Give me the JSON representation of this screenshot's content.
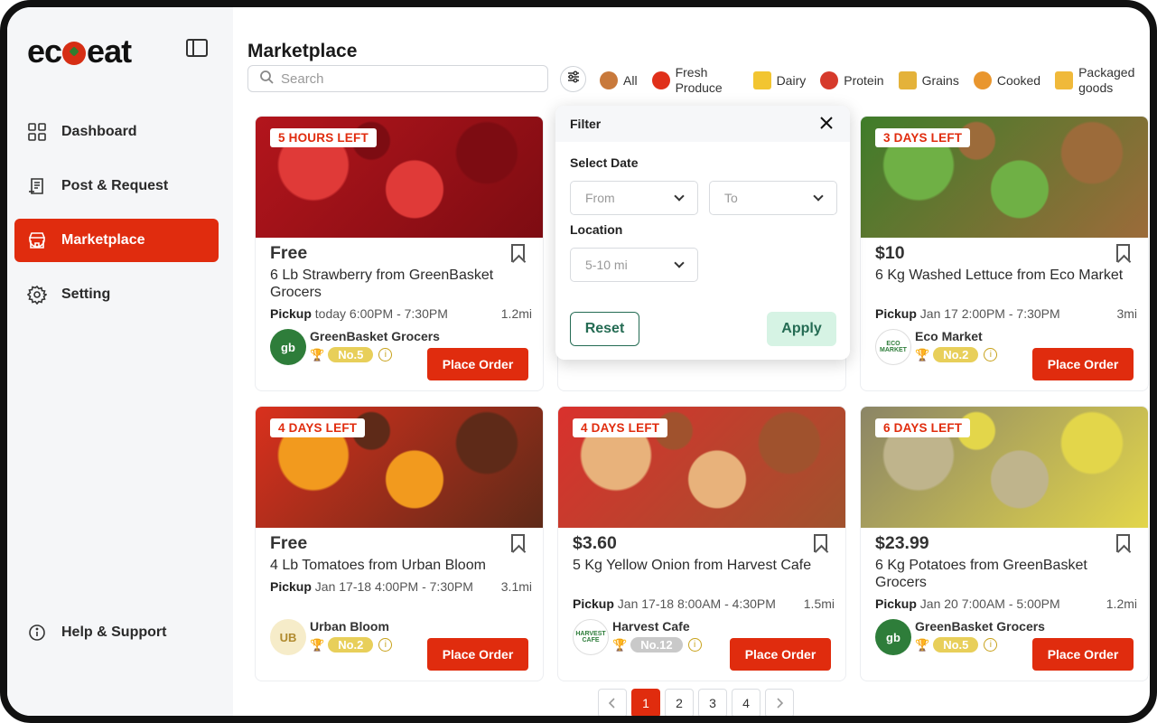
{
  "app": {
    "logo_text_left": "ec",
    "logo_text_right": "eat"
  },
  "sidebar": {
    "items": [
      {
        "label": "Dashboard",
        "icon": "grid-icon"
      },
      {
        "label": "Post & Request",
        "icon": "document-icon"
      },
      {
        "label": "Marketplace",
        "icon": "store-icon",
        "active": true
      },
      {
        "label": "Setting",
        "icon": "gear-icon"
      }
    ],
    "help_label": "Help & Support"
  },
  "page": {
    "title": "Marketplace",
    "search_placeholder": "Search"
  },
  "categories": [
    {
      "label": "All",
      "icon": "basket-icon",
      "color": "#c8793b"
    },
    {
      "label": "Fresh Produce",
      "icon": "tomato-icon",
      "color": "#e0301a"
    },
    {
      "label": "Dairy",
      "icon": "cheese-icon",
      "color": "#f2c531"
    },
    {
      "label": "Protein",
      "icon": "meat-icon",
      "color": "#d63a2b"
    },
    {
      "label": "Grains",
      "icon": "bread-icon",
      "color": "#e4b23a"
    },
    {
      "label": "Cooked",
      "icon": "pizza-icon",
      "color": "#e9962e"
    },
    {
      "label": "Packaged goods",
      "icon": "package-icon",
      "color": "#f0b93a"
    }
  ],
  "filter": {
    "title": "Filter",
    "date_label": "Select Date",
    "from_placeholder": "From",
    "to_placeholder": "To",
    "location_label": "Location",
    "location_value": "5-10 mi",
    "reset_label": "Reset",
    "apply_label": "Apply"
  },
  "pickup_label": "Pickup",
  "order_label": "Place Order",
  "cards": [
    {
      "badge": "5 HOURS LEFT",
      "price": "Free",
      "desc": "6 Lb Strawberry from GreenBasket Grocers",
      "pickup": "today 6:00PM - 7:30PM",
      "distance": "1.2mi",
      "seller": "GreenBasket Grocers",
      "rank": "No.5",
      "avatar": "gb",
      "avatar_color": "#2e7d3a",
      "img_colors": [
        "#b3151c",
        "#e03a38",
        "#7d0c12"
      ]
    },
    {
      "badge": "",
      "price": "",
      "desc": "",
      "pickup": "",
      "distance": "",
      "seller": "",
      "rank": "",
      "avatar": "",
      "avatar_color": "#ddd",
      "img_colors": [
        "#caa07a",
        "#8a5d3b",
        "#f0d9b5"
      ]
    },
    {
      "badge": "3 DAYS LEFT",
      "price": "$10",
      "desc": "6 Kg Washed Lettuce from Eco Market",
      "pickup": "Jan 17 2:00PM - 7:30PM",
      "distance": "3mi",
      "seller": "Eco Market",
      "rank": "No.2",
      "avatar": "ECO MARKET",
      "avatar_color": "#ffffff",
      "img_colors": [
        "#3f7d2a",
        "#6fb045",
        "#9c6b3a"
      ]
    },
    {
      "badge": "4 DAYS LEFT",
      "price": "Free",
      "desc": "4 Lb Tomatoes from Urban Bloom",
      "pickup": "Jan 17-18 4:00PM - 7:30PM",
      "distance": "3.1mi",
      "seller": "Urban Bloom",
      "rank": "No.2",
      "avatar": "UB",
      "avatar_color": "#f6ecc9",
      "img_colors": [
        "#d9301d",
        "#f29a1e",
        "#5e2a18"
      ]
    },
    {
      "badge": "4 DAYS LEFT",
      "price": "$3.60",
      "desc": "5 Kg Yellow Onion from Harvest Cafe",
      "pickup": "Jan 17-18 8:00AM - 4:30PM",
      "distance": "1.5mi",
      "seller": "Harvest Cafe",
      "rank": "No.12",
      "avatar": "HARVEST CAFE",
      "avatar_color": "#ffffff",
      "img_colors": [
        "#d9312d",
        "#e8b27b",
        "#a0522d"
      ]
    },
    {
      "badge": "6 DAYS LEFT",
      "price": "$23.99",
      "desc": "6 Kg Potatoes from GreenBasket Grocers",
      "pickup": "Jan 20 7:00AM - 5:00PM",
      "distance": "1.2mi",
      "seller": "GreenBasket Grocers",
      "rank": "No.5",
      "avatar": "gb",
      "avatar_color": "#2e7d3a",
      "img_colors": [
        "#8b8566",
        "#bfb48c",
        "#e3d64a"
      ]
    }
  ],
  "pagination": {
    "pages": [
      "1",
      "2",
      "3",
      "4"
    ],
    "current": "1",
    "prev_icon": "chevron-left-icon",
    "next_icon": "chevron-right-icon"
  },
  "colors": {
    "accent": "#e02c0e",
    "green": "#246b53",
    "gold": "#c8a21b"
  }
}
